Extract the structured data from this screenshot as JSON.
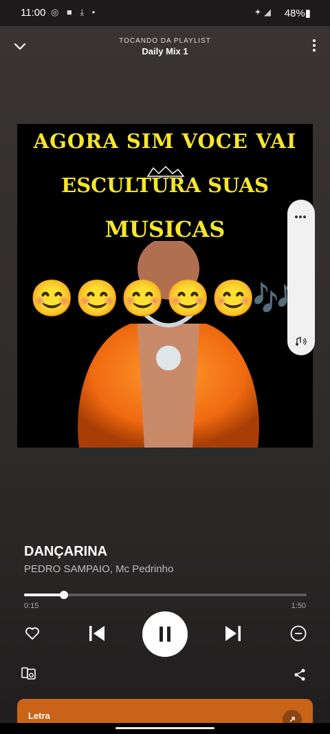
{
  "status_bar": {
    "time": "11:00",
    "left_icons": "◎ ■ ⤓ •",
    "signal": "✦ ◢",
    "battery": "48%▮"
  },
  "header": {
    "playing_from": "TOCANDO DA PLAYLIST",
    "playlist_name": "Daily Mix 1"
  },
  "album_art": {
    "line1": "AGORA SIM VOCE VAI",
    "line2": "ESCULTURA SUAS",
    "line3": "MUSICAS",
    "emojis": [
      "😊",
      "😊",
      "😊",
      "😊",
      "😊"
    ],
    "notes": "🎶"
  },
  "track": {
    "title": "DANÇARINA",
    "artist": "PEDRO SAMPAIO, Mc Pedrinho"
  },
  "playback": {
    "current": "0:15",
    "total": "1:50",
    "progress": 0.14
  },
  "lyrics_card": {
    "label": "Letra"
  },
  "colors": {
    "accent": "#c9631a",
    "text_yellow": "#f5e62a"
  }
}
